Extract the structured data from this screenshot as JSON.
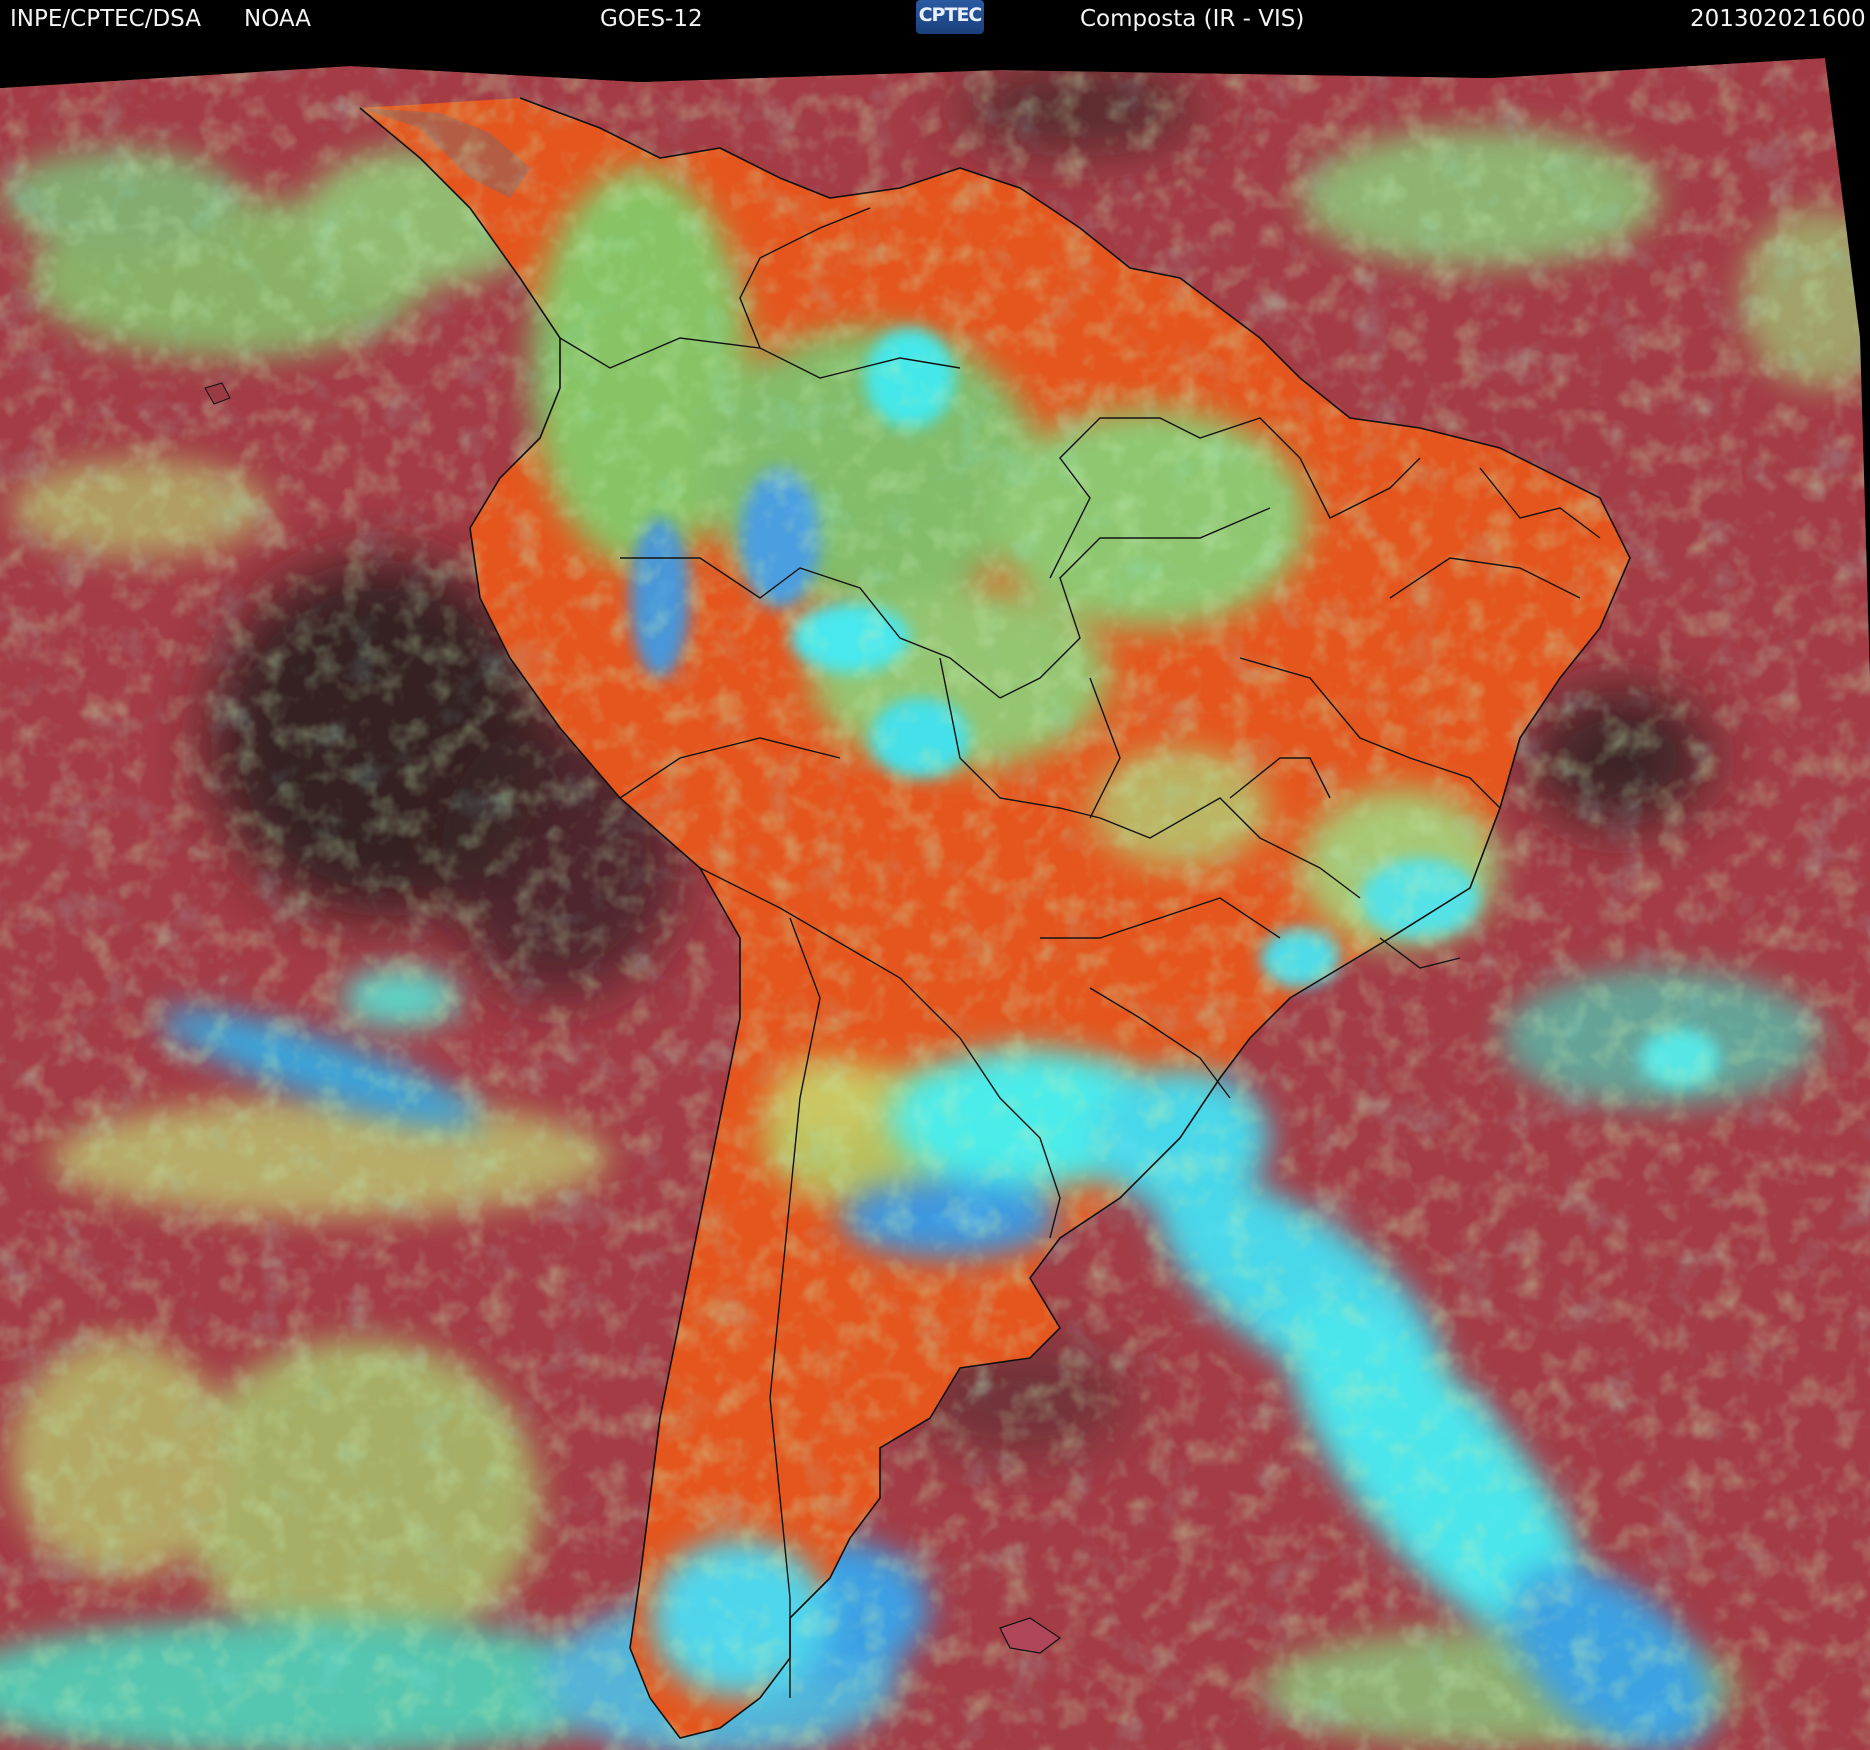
{
  "header": {
    "agency": "INPE/CPTEC/DSA",
    "partner": "NOAA",
    "satellite": "GOES-12",
    "logo_text": "CPTEC",
    "product": "Composta (IR - VIS)",
    "timestamp": "201302021600"
  },
  "logo_icon": "cptec-logo-icon",
  "colors": {
    "background": "#000000",
    "ocean": "#a23a44",
    "land_clear": "#e8581e",
    "low_cloud": "#8fd470",
    "high_cloud": "#41e8e8",
    "very_high_cloud": "#3aa0e8",
    "dark_ocean": "#2a1c1c",
    "borders": "#111111"
  }
}
